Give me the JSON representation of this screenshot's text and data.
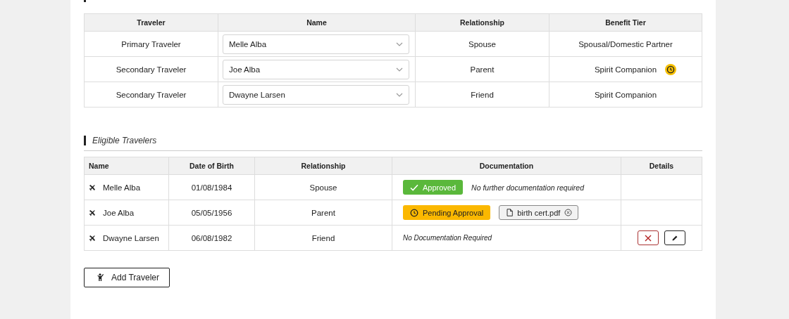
{
  "assigned": {
    "columns": [
      "Traveler",
      "Name",
      "Relationship",
      "Benefit Tier"
    ],
    "rows": [
      {
        "traveler": "Primary Traveler",
        "name": "Melle Alba",
        "relationship": "Spouse",
        "tier": "Spousal/Domestic Partner",
        "pending": false
      },
      {
        "traveler": "Secondary Traveler",
        "name": "Joe Alba",
        "relationship": "Parent",
        "tier": "Spirit Companion",
        "pending": true
      },
      {
        "traveler": "Secondary Traveler",
        "name": "Dwayne Larsen",
        "relationship": "Friend",
        "tier": "Spirit Companion",
        "pending": false
      }
    ]
  },
  "eligible": {
    "title": "Eligible Travelers",
    "columns": [
      "Name",
      "Date of Birth",
      "Relationship",
      "Documentation",
      "Details"
    ],
    "rows": [
      {
        "name": "Melle Alba",
        "dob": "01/08/1984",
        "relationship": "Spouse",
        "documentation": {
          "kind": "approved",
          "badge": "Approved",
          "note": "No further documentation required"
        },
        "actions": false
      },
      {
        "name": "Joe Alba",
        "dob": "05/05/1956",
        "relationship": "Parent",
        "documentation": {
          "kind": "pending",
          "badge": "Pending Approval",
          "file": "birth cert.pdf"
        },
        "actions": false
      },
      {
        "name": "Dwayne Larsen",
        "dob": "06/08/1982",
        "relationship": "Friend",
        "documentation": {
          "kind": "none",
          "note": "No Documentation Required"
        },
        "actions": true
      }
    ]
  },
  "add_button": "Add Traveler"
}
